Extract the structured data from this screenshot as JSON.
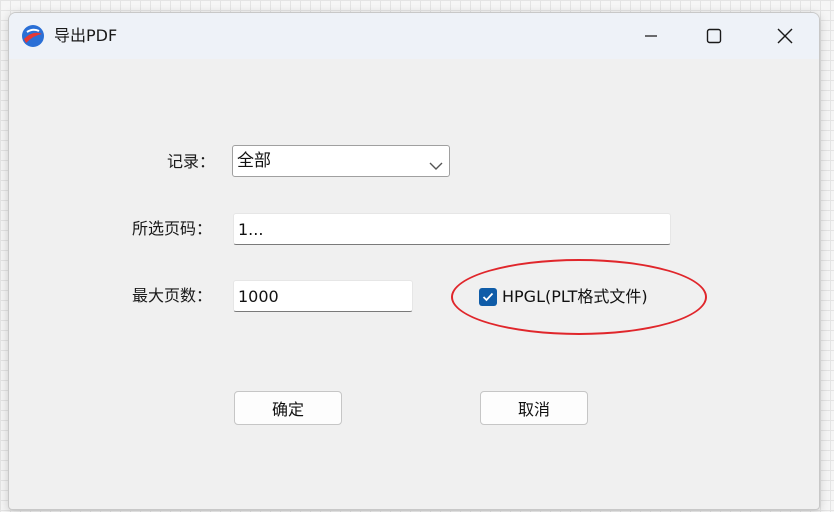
{
  "window": {
    "title": "导出PDF",
    "controls": {
      "minimize": "minimize",
      "maximize": "maximize",
      "close": "close"
    }
  },
  "form": {
    "record": {
      "label": "记录：",
      "selected": "全部"
    },
    "selected_pages": {
      "label": "所选页码：",
      "value": "1..."
    },
    "max_pages": {
      "label": "最大页数：",
      "value": "1000"
    },
    "hpgl": {
      "label": "HPGL(PLT格式文件)",
      "checked": true
    }
  },
  "buttons": {
    "ok": "确定",
    "cancel": "取消"
  },
  "icons": {
    "app": "app-logo-icon",
    "dropdown": "chevron-down-icon",
    "check": "checkmark-icon"
  },
  "colors": {
    "checkbox": "#0f5ca8",
    "annotation": "#e0262b",
    "titlebar": "#eef2f8",
    "window": "#f0f0f0"
  }
}
